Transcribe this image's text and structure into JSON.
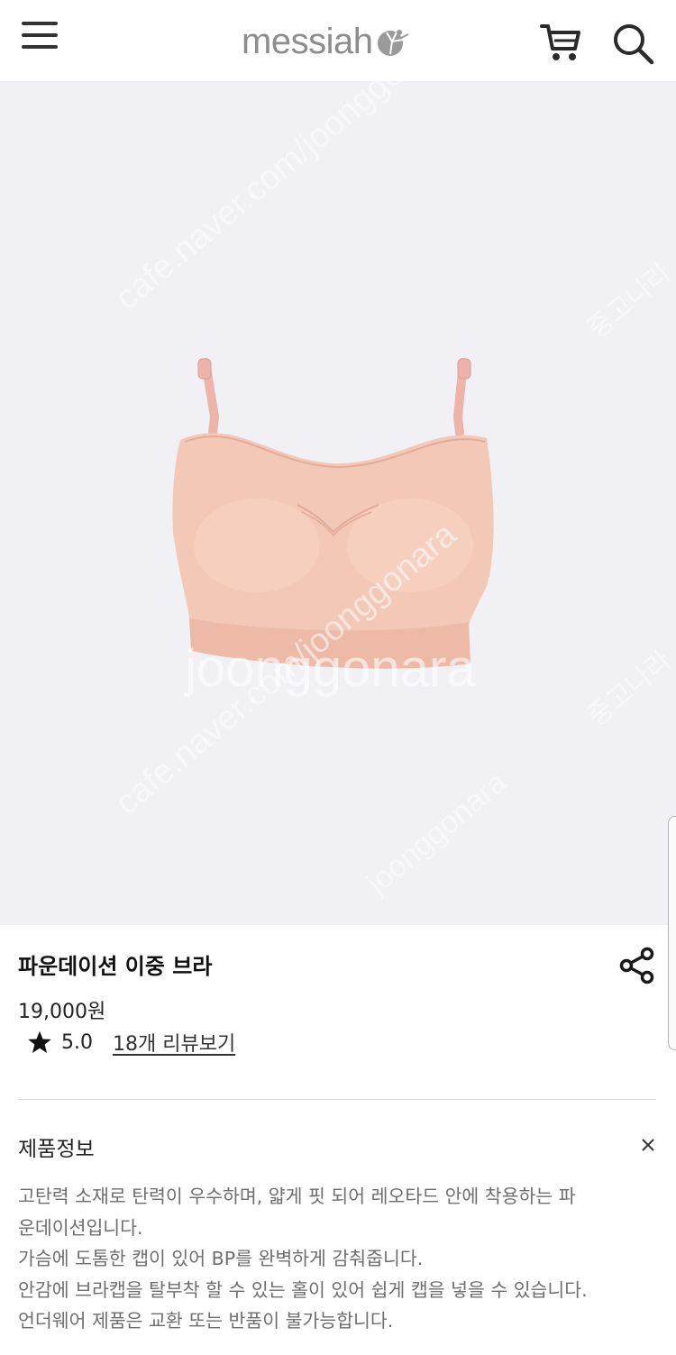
{
  "header": {
    "logo_text": "messiah",
    "icons": {
      "menu": "hamburger-menu-icon",
      "cart": "shopping-cart-icon",
      "search": "search-icon",
      "logo_mark": "ballerina-logo-icon"
    }
  },
  "watermark": {
    "texts": [
      "cafe.naver.com/joonggonara",
      "joonggonara",
      "cafe.naver.com/joonggonara",
      "joonggonara",
      "중고나라",
      "중고나라"
    ]
  },
  "product": {
    "title": "파운데이션 이중 브라",
    "price": "19,000원",
    "rating": "5.0",
    "review_link": "18개 리뷰보기",
    "image_subject": "nude-pink seamless bra",
    "colors": {
      "bra": "#f1c2b0",
      "strap": "#efb4a9",
      "background": "#f0f0f5"
    }
  },
  "info": {
    "section_title": "제품정보",
    "description_lines": [
      "고탄력 소재로 탄력이 우수하며, 얇게 핏 되어 레오타드 안에 착용하는 파",
      "운데이션입니다.",
      "가슴에 도톰한 캡이 있어 BP를 완벽하게 감춰줍니다.",
      "안감에 브라캡을 탈부착 할 수 있는 홀이 있어 쉽게 캡을 넣을 수 있습니다.",
      "언더웨어 제품은 교환 또는 반품이 불가능합니다."
    ]
  }
}
